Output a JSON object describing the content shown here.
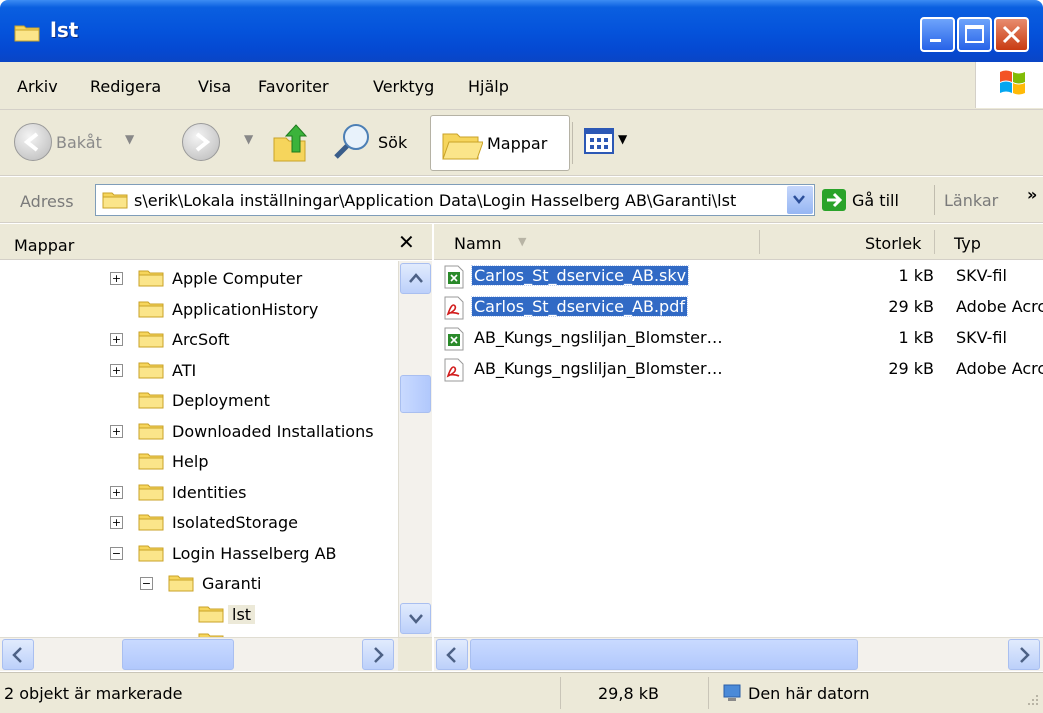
{
  "window": {
    "title": "lst"
  },
  "menu": [
    "Arkiv",
    "Redigera",
    "Visa",
    "Favoriter",
    "Verktyg",
    "Hjälp"
  ],
  "toolbar": {
    "back_label": "Bakåt",
    "search_label": "Sök",
    "folders_label": "Mappar"
  },
  "address": {
    "label": "Adress",
    "value": "s\\erik\\Lokala inställningar\\Application Data\\Login Hasselberg AB\\Garanti\\lst",
    "go_label": "Gå till",
    "links_label": "Länkar"
  },
  "folder_pane": {
    "title": "Mappar",
    "items": [
      {
        "label": "Apple Computer",
        "expander": "+"
      },
      {
        "label": "ApplicationHistory",
        "expander": ""
      },
      {
        "label": "ArcSoft",
        "expander": "+"
      },
      {
        "label": "ATI",
        "expander": "+"
      },
      {
        "label": "Deployment",
        "expander": ""
      },
      {
        "label": "Downloaded Installations",
        "expander": "+"
      },
      {
        "label": "Help",
        "expander": ""
      },
      {
        "label": "Identities",
        "expander": "+"
      },
      {
        "label": "IsolatedStorage",
        "expander": "+"
      },
      {
        "label": "Login Hasselberg AB",
        "expander": "−"
      },
      {
        "label": "Garanti",
        "expander": "−"
      },
      {
        "label": "lst",
        "expander": "",
        "selected": true
      }
    ]
  },
  "file_pane": {
    "columns": {
      "name": "Namn",
      "size": "Storlek",
      "type": "Typ"
    },
    "files": [
      {
        "name": "Carlos_St_dservice_AB.skv",
        "size": "1 kB",
        "type": "SKV-fil",
        "icon": "spreadsheet-icon",
        "selected": true
      },
      {
        "name": "Carlos_St_dservice_AB.pdf",
        "size": "29 kB",
        "type": "Adobe Acrc",
        "icon": "pdf-icon",
        "selected": true
      },
      {
        "name": "AB_Kungs_ngsliljan_Blomster…",
        "size": "1 kB",
        "type": "SKV-fil",
        "icon": "spreadsheet-icon",
        "selected": false
      },
      {
        "name": "AB_Kungs_ngsliljan_Blomster…",
        "size": "29 kB",
        "type": "Adobe Acrc",
        "icon": "pdf-icon",
        "selected": false
      }
    ]
  },
  "status": {
    "selection": "2 objekt är markerade",
    "size": "29,8 kB",
    "location": "Den här datorn"
  },
  "colors": {
    "title_bar": "#0553db",
    "selection": "#316ac5",
    "chrome": "#ece9d8"
  }
}
